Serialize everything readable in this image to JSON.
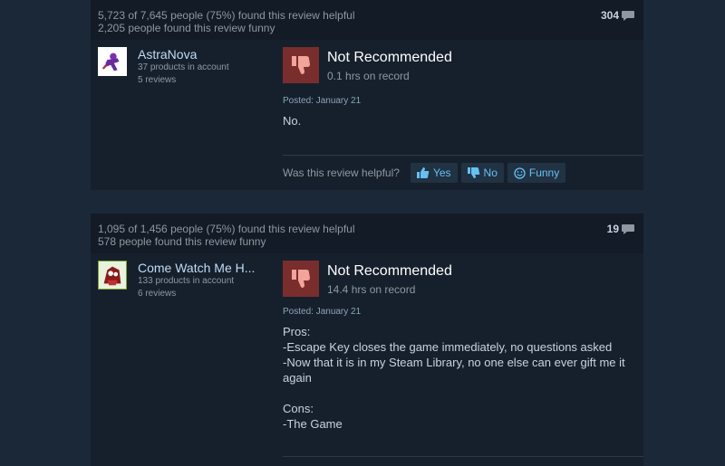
{
  "reviews": [
    {
      "helpful_text": "5,723 of 7,645 people (75%) found this review helpful",
      "funny_text": "2,205 people found this review funny",
      "comment_count": "304",
      "author": {
        "name": "AstraNova",
        "products": "37 products in account",
        "reviews": "5 reviews"
      },
      "verdict": "Not Recommended",
      "hours": "0.1 hrs on record",
      "posted": "Posted: January 21",
      "body": "No.",
      "vote": {
        "question": "Was this review helpful?",
        "yes": "Yes",
        "no": "No",
        "funny": "Funny"
      }
    },
    {
      "helpful_text": "1,095 of 1,456 people (75%) found this review helpful",
      "funny_text": "578 people found this review funny",
      "comment_count": "19",
      "author": {
        "name": "Come Watch Me H...",
        "products": "133 products in account",
        "reviews": "6 reviews"
      },
      "verdict": "Not Recommended",
      "hours": "14.4 hrs on record",
      "posted": "Posted: January 21",
      "body": "Pros:\n-Escape Key closes the game immediately, no questions asked\n-Now that it is in my Steam Library, no one else can ever gift me it again\n\nCons:\n-The Game"
    }
  ],
  "colors": {
    "background": "#1b2838",
    "card": "#16202d",
    "header": "#121b26",
    "accent_link": "#66c0f4",
    "not_recommended": "#7a2d2d"
  },
  "icons": {
    "comment": "comment-bubble-icon",
    "thumbs_down": "thumbs-down-icon",
    "thumbs_up": "thumbs-up-icon",
    "funny": "smiley-icon"
  }
}
